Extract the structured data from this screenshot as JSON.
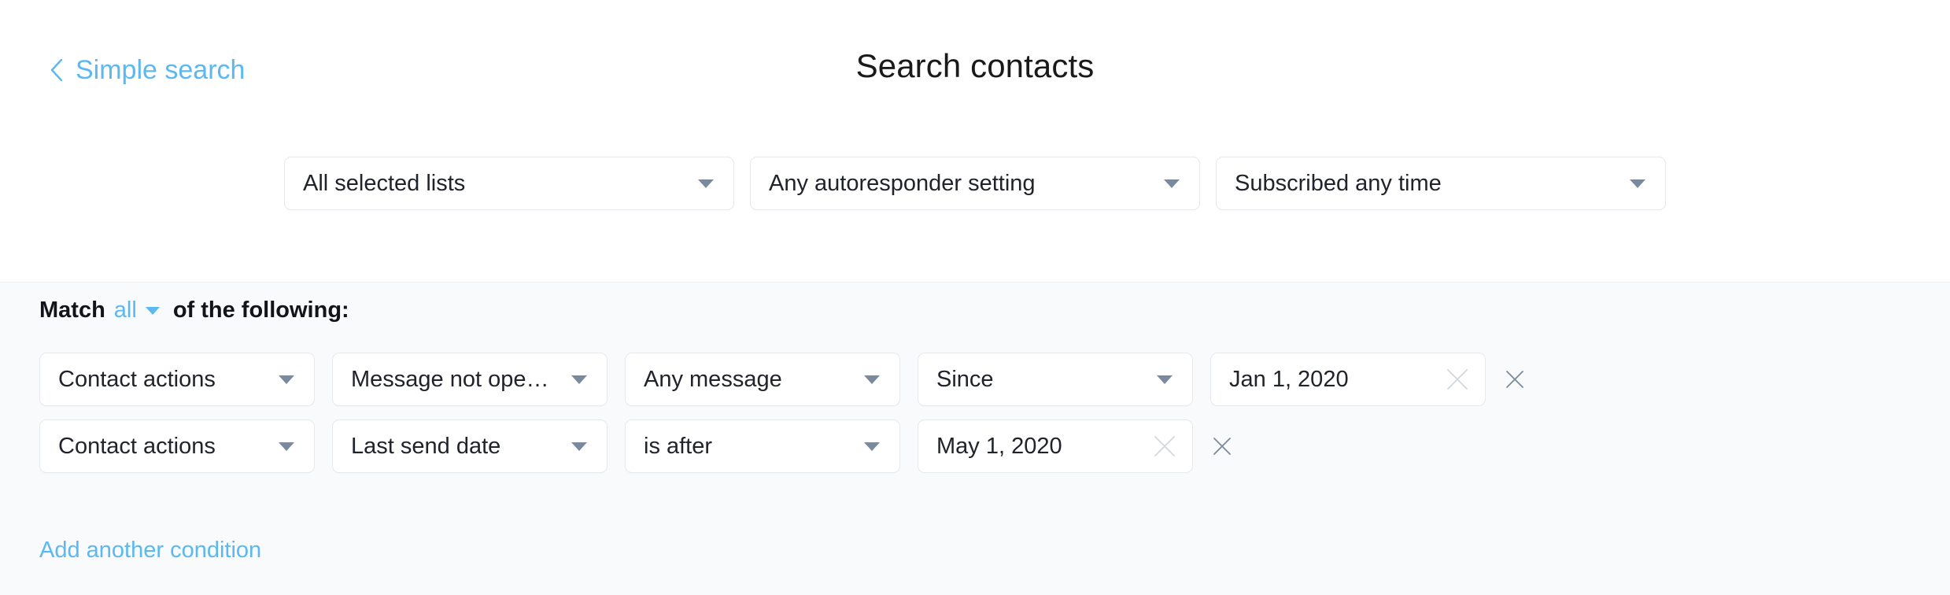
{
  "header": {
    "back_link": "Simple search",
    "back_icon": "chevron-left-icon",
    "title": "Search contacts"
  },
  "filters": [
    {
      "label": "All selected lists",
      "icon": "chevron-down-icon"
    },
    {
      "label": "Any autoresponder setting",
      "icon": "chevron-down-icon"
    },
    {
      "label": "Subscribed any time",
      "icon": "chevron-down-icon"
    }
  ],
  "match": {
    "prefix": "Match",
    "value": "all",
    "suffix": "of the following:",
    "icon": "chevron-down-icon"
  },
  "conditions": [
    {
      "field": "Contact actions",
      "attribute": "Message not open…",
      "target": "Any message",
      "operator": "Since",
      "date": "Jan 1, 2020",
      "clear_icon": "close-icon",
      "remove_icon": "close-icon"
    },
    {
      "field": "Contact actions",
      "attribute": "Last send date",
      "operator": "is after",
      "date": "May 1, 2020",
      "clear_icon": "close-icon",
      "remove_icon": "close-icon"
    }
  ],
  "add_condition": "Add another condition",
  "colors": {
    "accent": "#5cb8f0",
    "panel_bg": "#f8fafc",
    "border": "#e6e9ed",
    "caret": "#7a8a9c",
    "clear_x": "#d4d8dd",
    "remove_x": "#7a8a9c",
    "text": "#20232a"
  }
}
